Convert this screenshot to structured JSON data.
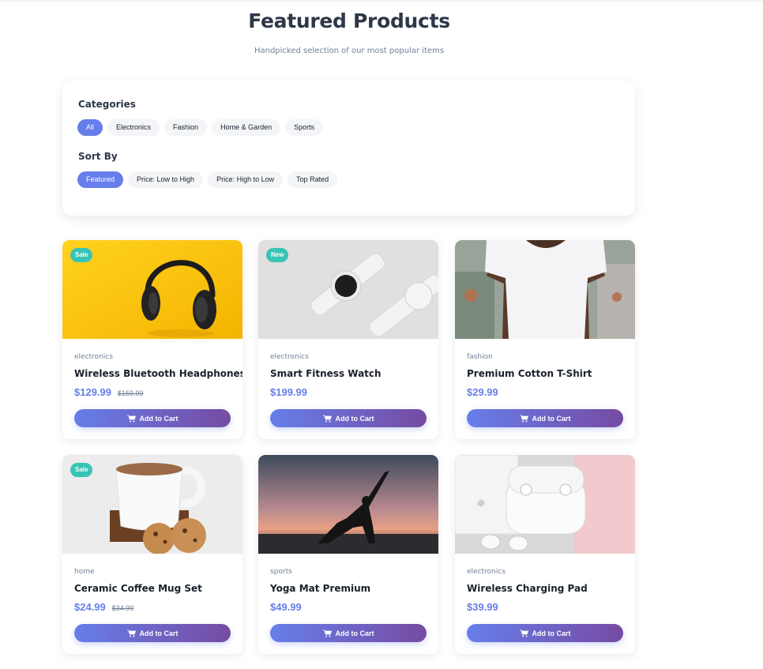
{
  "header": {
    "title": "Featured Products",
    "subtitle": "Handpicked selection of our most popular items"
  },
  "filters": {
    "categories_heading": "Categories",
    "categories": [
      {
        "label": "All",
        "active": true
      },
      {
        "label": "Electronics",
        "active": false
      },
      {
        "label": "Fashion",
        "active": false
      },
      {
        "label": "Home & Garden",
        "active": false
      },
      {
        "label": "Sports",
        "active": false
      }
    ],
    "sort_heading": "Sort By",
    "sort_options": [
      {
        "label": "Featured",
        "active": true
      },
      {
        "label": "Price: Low to High",
        "active": false
      },
      {
        "label": "Price: High to Low",
        "active": false
      },
      {
        "label": "Top Rated",
        "active": false
      }
    ]
  },
  "products": [
    {
      "badge": "Sale",
      "category": "electronics",
      "name": "Wireless Bluetooth Headphones",
      "price": "$129.99",
      "old_price": "$159.99",
      "button": "Add to Cart",
      "image": "headphones-photo"
    },
    {
      "badge": "New",
      "category": "electronics",
      "name": "Smart Fitness Watch",
      "price": "$199.99",
      "old_price": "",
      "button": "Add to Cart",
      "image": "smartwatch-photo"
    },
    {
      "badge": "",
      "category": "fashion",
      "name": "Premium Cotton T-Shirt",
      "price": "$29.99",
      "old_price": "",
      "button": "Add to Cart",
      "image": "tshirt-photo"
    },
    {
      "badge": "Sale",
      "category": "home",
      "name": "Ceramic Coffee Mug Set",
      "price": "$24.99",
      "old_price": "$34.99",
      "button": "Add to Cart",
      "image": "coffee-mug-photo"
    },
    {
      "badge": "",
      "category": "sports",
      "name": "Yoga Mat Premium",
      "price": "$49.99",
      "old_price": "",
      "button": "Add to Cart",
      "image": "yoga-photo"
    },
    {
      "badge": "",
      "category": "electronics",
      "name": "Wireless Charging Pad",
      "price": "$39.99",
      "old_price": "",
      "button": "Add to Cart",
      "image": "earbuds-photo"
    }
  ],
  "colors": {
    "accent": "#667eea",
    "gradient_end": "#764ba2",
    "badge": "#38c4b5"
  },
  "icons": {
    "cart": "shopping-cart-icon"
  }
}
